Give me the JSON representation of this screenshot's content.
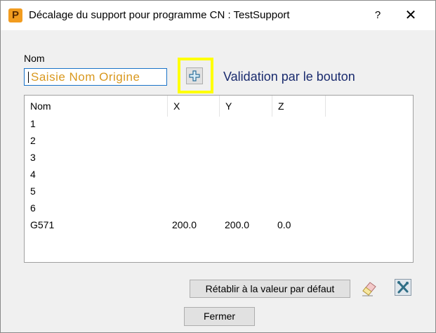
{
  "window": {
    "title": "Décalage du support pour programme CN : TestSupport",
    "app_icon_letter": "P",
    "help_label": "?",
    "close_label": "✕"
  },
  "form": {
    "name_label": "Nom",
    "name_value": "Saisie Nom Origine",
    "add_button_icon": "add-origin-icon",
    "annotation": "Validation par le bouton"
  },
  "table": {
    "columns": [
      "Nom",
      "X",
      "Y",
      "Z"
    ],
    "rows": [
      {
        "name": "1",
        "x": "",
        "y": "",
        "z": ""
      },
      {
        "name": "2",
        "x": "",
        "y": "",
        "z": ""
      },
      {
        "name": "3",
        "x": "",
        "y": "",
        "z": ""
      },
      {
        "name": "4",
        "x": "",
        "y": "",
        "z": ""
      },
      {
        "name": "5",
        "x": "",
        "y": "",
        "z": ""
      },
      {
        "name": "6",
        "x": "",
        "y": "",
        "z": ""
      },
      {
        "name": "G571",
        "x": "200.0",
        "y": "200.0",
        "z": "0.0"
      }
    ]
  },
  "footer": {
    "reset_label": "Rétablir à la valeur par défaut",
    "eraser_icon": "eraser-icon",
    "tool_icon": "tool-x-icon",
    "close_label": "Fermer"
  },
  "colors": {
    "name_value": "#d9981e",
    "annotation": "#1a2b6e",
    "highlight": "#ffff00",
    "input_border": "#1a73c8"
  }
}
